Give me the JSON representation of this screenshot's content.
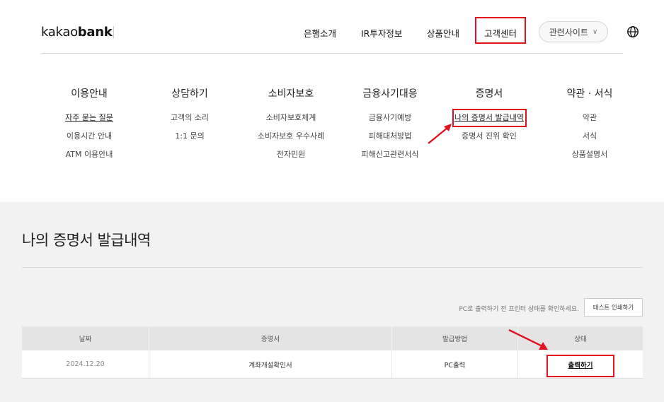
{
  "header": {
    "logo_light": "kakao",
    "logo_bold": "bank",
    "nav": [
      "은행소개",
      "IR투자정보",
      "상품안내",
      "고객센터"
    ],
    "related_label": "관련사이트",
    "globe_icon": "globe-icon",
    "chevron_icon": "chevron-down-icon"
  },
  "menu": {
    "columns": [
      {
        "title": "이용안내",
        "links": [
          "자주 묻는 질문",
          "이용시간 안내",
          "ATM 이용안내"
        ]
      },
      {
        "title": "상담하기",
        "links": [
          "고객의 소리",
          "1:1 문의"
        ]
      },
      {
        "title": "소비자보호",
        "links": [
          "소비자보호체계",
          "소비자보호 우수사례",
          "전자민원"
        ]
      },
      {
        "title": "금융사기대응",
        "links": [
          "금융사기예방",
          "피해대처방법",
          "피해신고관련서식"
        ]
      },
      {
        "title": "증명서",
        "links": [
          "나의 증명서 발급내역",
          "증명서 진위 확인"
        ]
      },
      {
        "title": "약관 · 서식",
        "links": [
          "약관",
          "서식",
          "상품설명서"
        ]
      }
    ]
  },
  "page": {
    "title": "나의 증명서 발급내역",
    "notice": "PC로 출력하기 전 프린터 상태를 확인하세요.",
    "test_print_label": "테스트 인쇄하기"
  },
  "table": {
    "headers": [
      "날짜",
      "증명서",
      "발급방법",
      "상태"
    ],
    "rows": [
      {
        "date": "2024.12.20",
        "certificate": "계좌개설확인서",
        "method": "PC출력",
        "status": "출력하기"
      }
    ]
  },
  "colors": {
    "highlight": "#e0121b",
    "section_bg": "#f2f2f2"
  }
}
